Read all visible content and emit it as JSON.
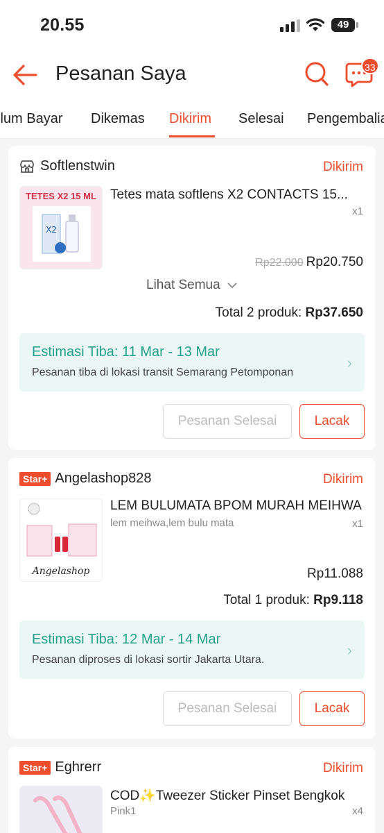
{
  "status_bar": {
    "time": "20.55",
    "battery": "49"
  },
  "header": {
    "title": "Pesanan Saya",
    "chat_badge": "33"
  },
  "tabs": [
    {
      "label": "Belum Bayar"
    },
    {
      "label": "Dikemas"
    },
    {
      "label": "Dikirim",
      "active": true
    },
    {
      "label": "Selesai"
    },
    {
      "label": "Pengembalian"
    }
  ],
  "orders": [
    {
      "shop": "Softlenstwin",
      "status": "Dikirim",
      "product": "Tetes mata softlens X2 CONTACTS 15...",
      "image_text": "TETES X2 15 ML",
      "qty": "x1",
      "old_price": "Rp22.000",
      "price": "Rp20.750",
      "see_all": "Lihat Semua",
      "total_label": "Total 2 produk:",
      "total_value": "Rp37.650",
      "estimate_title": "Estimasi Tiba: 11 Mar - 13 Mar",
      "estimate_sub": "Pesanan tiba di lokasi transit  Semarang Petomponan",
      "btn_done": "Pesanan Selesai",
      "btn_track": "Lacak"
    },
    {
      "shop": "Angelashop828",
      "star": "Star+",
      "status": "Dikirim",
      "product": "LEM BULUMATA BPOM MURAH MEIHWA",
      "image_text": "Angelashop",
      "variant": "lem meihwa,lem bulu mata",
      "qty": "x1",
      "price": "Rp11.088",
      "total_label": "Total 1 produk:",
      "total_value": "Rp9.118",
      "estimate_title": "Estimasi Tiba: 12 Mar - 14 Mar",
      "estimate_sub": "Pesanan diproses di lokasi sortir  Jakarta Utara.",
      "btn_done": "Pesanan Selesai",
      "btn_track": "Lacak"
    },
    {
      "shop": "Eghrerr",
      "star": "Star+",
      "status": "Dikirim",
      "product": "COD✨Tweezer Sticker Pinset Bengkok",
      "variant": "Pink1",
      "qty": "x4"
    }
  ],
  "colors": {
    "accent": "#ee4d2d",
    "estimate_green": "#26a08a"
  }
}
